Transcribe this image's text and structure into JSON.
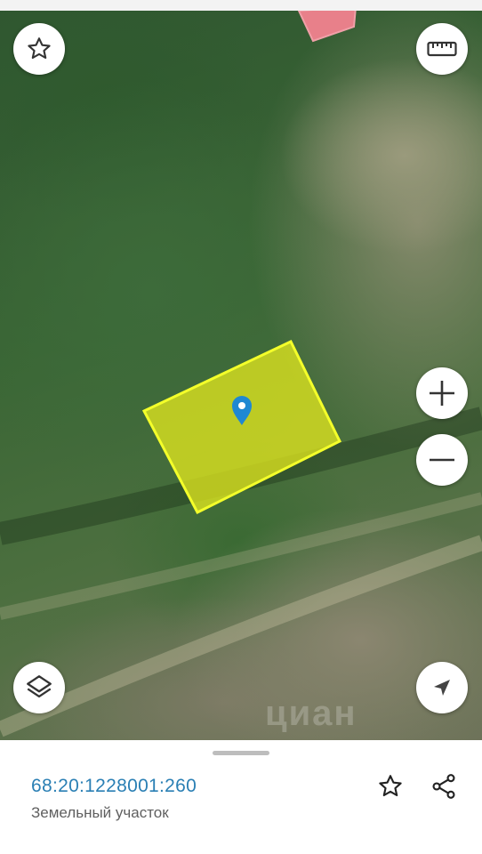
{
  "map": {
    "parcel_color": "#e6eb1e",
    "marker_color": "#1e88d2",
    "watermark": "циан",
    "buttons": {
      "favorite": "star-outline-icon",
      "measure": "ruler-icon",
      "zoom_in": "plus-icon",
      "zoom_out": "minus-icon",
      "layers": "layers-icon",
      "locate": "navigation-arrow-icon"
    }
  },
  "sheet": {
    "cadastral_number": "68:20:1228001:260",
    "object_type": "Земельный участок",
    "icons": [
      "star-outline-icon",
      "share-icon"
    ]
  }
}
